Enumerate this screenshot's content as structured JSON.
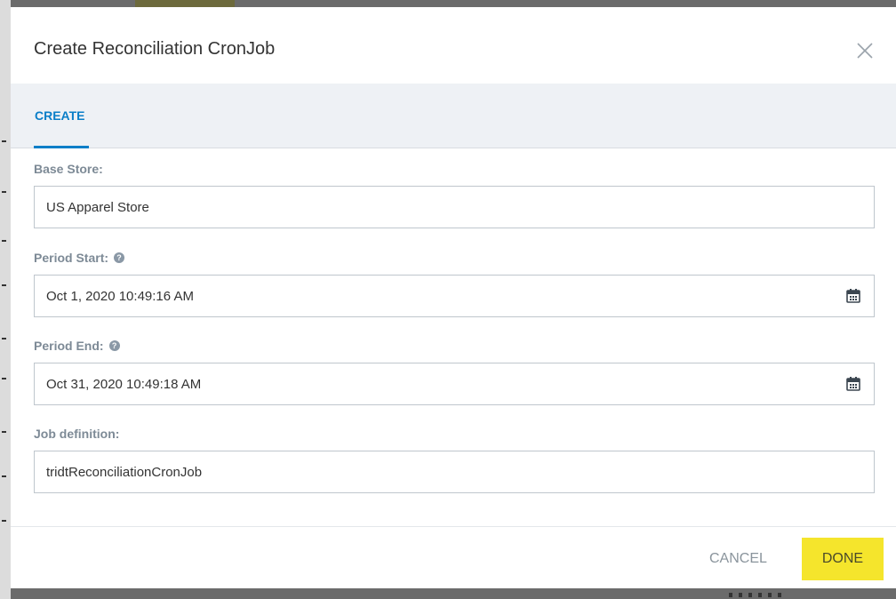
{
  "dialog": {
    "title": "Create Reconciliation CronJob",
    "close_icon": "close-icon"
  },
  "tabs": [
    {
      "label": "CREATE",
      "active": true
    }
  ],
  "fields": {
    "base_store": {
      "label": "Base Store:",
      "value": "US Apparel Store"
    },
    "period_start": {
      "label": "Period Start:",
      "value": "Oct 1, 2020 10:49:16 AM",
      "icon": "calendar-icon"
    },
    "period_end": {
      "label": "Period End:",
      "value": "Oct 31, 2020 10:49:18 AM",
      "icon": "calendar-icon"
    },
    "job_definition": {
      "label": "Job definition:",
      "value": "tridtReconciliationCronJob"
    }
  },
  "help_icon_glyph": "?",
  "footer": {
    "cancel_label": "CANCEL",
    "done_label": "DONE"
  },
  "colors": {
    "accent": "#0a7ec8",
    "done_button": "#f5e52c",
    "label": "#7d8a96"
  }
}
